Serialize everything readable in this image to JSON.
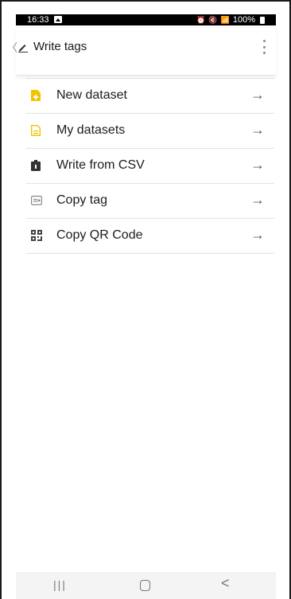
{
  "status": {
    "time": "16:33",
    "right_icons": "⏰ 🔇 📶",
    "battery": "100%"
  },
  "appbar": {
    "title": "Write tags"
  },
  "menu_items": [
    {
      "label": "New dataset",
      "icon": "new-dataset-icon",
      "color": "#f2c400"
    },
    {
      "label": "My datasets",
      "icon": "my-datasets-icon",
      "color": "#f2c400"
    },
    {
      "label": "Write from CSV",
      "icon": "write-csv-icon",
      "color": "#333333"
    },
    {
      "label": "Copy tag",
      "icon": "copy-tag-icon",
      "color": "#8a8a8a"
    },
    {
      "label": "Copy QR Code",
      "icon": "qr-code-icon",
      "color": "#444444"
    }
  ],
  "arrow_glyph": "→",
  "navbar": {
    "recents": "|||",
    "back": "<"
  }
}
